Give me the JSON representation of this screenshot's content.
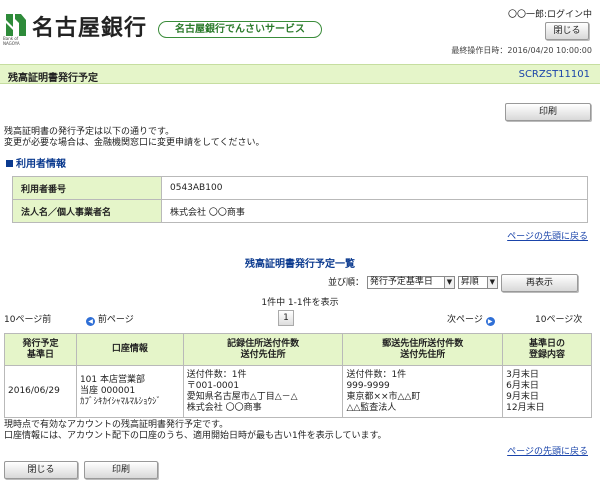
{
  "header": {
    "bank_name": "名古屋銀行",
    "logo_sub_1": "Bank of",
    "logo_sub_2": "NAGOYA",
    "service_name": "名古屋銀行でんさいサービス",
    "user_status": "〇〇一郎:ログイン中",
    "close_label": "閉じる",
    "last_operation": "最終操作日時：2016/04/20 10:00:00",
    "brand_color": "#2a7a2a",
    "logo_color": "#2e8b3a"
  },
  "title_bar": {
    "title": "残高証明書発行予定",
    "screen_code": "SCRZST11101"
  },
  "toolbar": {
    "print_label": "印刷"
  },
  "intro": {
    "line1": "残高証明書の発行予定は以下の通りです。",
    "line2": "変更が必要な場合は、金融機関窓口に変更申請をしてください。"
  },
  "user_info": {
    "section_title": "利用者情報",
    "rows": [
      {
        "label": "利用者番号",
        "value": "0543AB100"
      },
      {
        "label": "法人名／個人事業者名",
        "value": "株式会社 〇〇商事"
      }
    ]
  },
  "links": {
    "to_top": "ページの先頭に戻る"
  },
  "list": {
    "title": "残高証明書発行予定一覧",
    "sort_label": "並び順：",
    "sort_key": "発行予定基準日",
    "sort_order": "昇順",
    "redisplay_label": "再表示",
    "count_text": "1件中 1-1件を表示",
    "pager": {
      "prev10": "10ページ前",
      "prev": "前ページ",
      "current_page": "1",
      "next": "次ページ",
      "next10": "10ページ次"
    },
    "columns": [
      [
        "発行予定",
        "基準日"
      ],
      [
        "口座情報"
      ],
      [
        "記録住所送付件数",
        "送付先住所"
      ],
      [
        "郵送先住所送付件数",
        "送付先住所"
      ],
      [
        "基準日の",
        "登録内容"
      ]
    ],
    "rows": [
      {
        "date": "2016/06/29",
        "account": [
          "101 本店営業部",
          "当座 000001",
          "ｶﾌﾞｼｷｶｲｼｬﾏﾙﾏﾙｼｮｳｼﾞ"
        ],
        "record_addr": [
          "送付件数：1件",
          "〒001-0001",
          "愛知県名古屋市△丁目△－△",
          "株式会社 〇〇商事"
        ],
        "mail_addr": [
          "送付件数：1件",
          "999-9999",
          "東京都××市△△町",
          "△△監査法人"
        ],
        "registered": [
          "3月末日",
          "6月末日",
          "9月末日",
          "12月末日"
        ]
      }
    ]
  },
  "notes": {
    "line1": "現時点で有効なアカウントの残高証明書発行予定です。",
    "line2": "口座情報には、アカウント配下の口座のうち、適用開始日時が最も古い1件を表示しています。"
  },
  "footer": {
    "close_label": "閉じる",
    "print_label": "印刷"
  }
}
